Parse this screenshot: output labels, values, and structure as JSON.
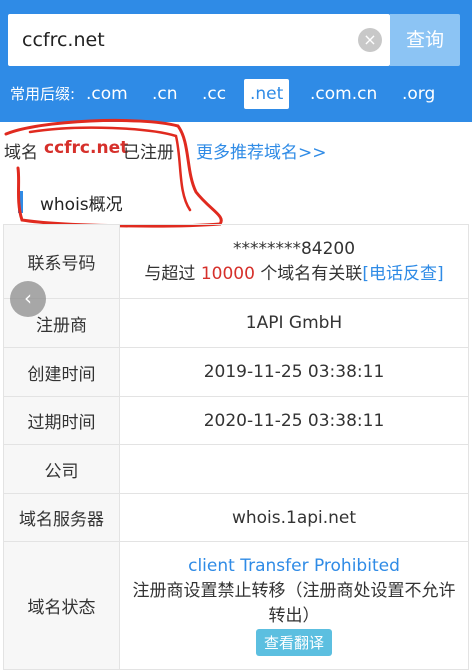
{
  "search": {
    "value": "ccfrc.net",
    "clear_glyph": "×",
    "button_label": "查询"
  },
  "suffixes": {
    "label": "常用后缀:",
    "items": [
      ".com",
      ".cn",
      ".cc",
      ".net",
      ".com.cn",
      ".org"
    ],
    "active": ".net"
  },
  "registration": {
    "prefix": "域名",
    "domain": "ccfrc.net",
    "suffix": "已注册",
    "more_link": "更多推荐域名>>"
  },
  "section": {
    "title": "whois概况"
  },
  "whois": {
    "phone": {
      "label": "联系号码",
      "masked": "********84200",
      "related_prefix": "与超过",
      "related_count": "10000",
      "related_suffix": "个域名有关联",
      "reverse_link": "[电话反查]"
    },
    "registrar": {
      "label": "注册商",
      "value": "1API GmbH"
    },
    "created": {
      "label": "创建时间",
      "value": "2019-11-25 03:38:11"
    },
    "expires": {
      "label": "过期时间",
      "value": "2020-11-25 03:38:11"
    },
    "company": {
      "label": "公司",
      "value": ""
    },
    "nameserver": {
      "label": "域名服务器",
      "value": "whois.1api.net"
    },
    "status": {
      "label": "域名状态",
      "code": "client Transfer Prohibited",
      "description": "注册商设置禁止转移（注册商处设置不允许转出）",
      "translate_button": "查看翻译"
    }
  },
  "back_glyph": "‹",
  "colors": {
    "header": "#2f8be6",
    "query_button": "#8cc4f4",
    "highlight": "#d6302b",
    "link": "#2f8be6",
    "annotation": "#e02a1f"
  }
}
